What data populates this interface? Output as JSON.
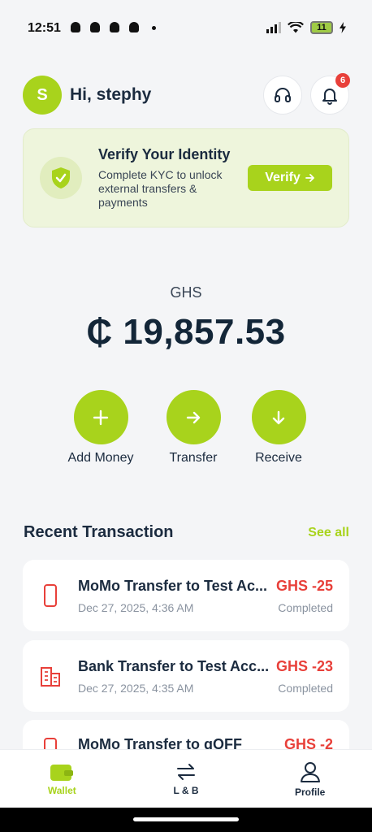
{
  "status": {
    "time": "12:51",
    "battery": "11",
    "snap_icon": "snapchat-ghost-icon"
  },
  "header": {
    "avatar_initial": "S",
    "greeting": "Hi, stephy",
    "support_icon": "headphones-icon",
    "notification_icon": "bell-icon",
    "notification_count": "6"
  },
  "kyc": {
    "title": "Verify Your Identity",
    "description": "Complete KYC to unlock external transfers & payments",
    "button_label": "Verify",
    "icon": "shield-check-icon"
  },
  "balance": {
    "currency": "GHS",
    "amount": "₵ 19,857.53"
  },
  "actions": [
    {
      "label": "Add Money",
      "icon": "plus-icon"
    },
    {
      "label": "Transfer",
      "icon": "arrow-right-icon"
    },
    {
      "label": "Receive",
      "icon": "arrow-down-icon"
    }
  ],
  "recent": {
    "title": "Recent Transaction",
    "see_all": "See all"
  },
  "transactions": [
    {
      "title": "MoMo Transfer to Test Ac...",
      "date": "Dec 27, 2025, 4:36 AM",
      "amount": "GHS -25",
      "status": "Completed",
      "icon": "phone-icon"
    },
    {
      "title": "Bank Transfer to Test Acc...",
      "date": "Dec 27, 2025, 4:35 AM",
      "amount": "GHS -23",
      "status": "Completed",
      "icon": "bank-building-icon"
    },
    {
      "title": "MoMo Transfer to gOFF",
      "amount": "GHS -2",
      "icon": "phone-icon"
    }
  ],
  "nav": [
    {
      "label": "Wallet",
      "icon": "wallet-icon",
      "active": true
    },
    {
      "label": "L & B",
      "icon": "swap-arrows-icon",
      "active": false
    },
    {
      "label": "Profile",
      "icon": "user-icon",
      "active": false
    }
  ],
  "colors": {
    "accent": "#a8d31c",
    "negative": "#e8403a",
    "text": "#1b2b3f"
  }
}
